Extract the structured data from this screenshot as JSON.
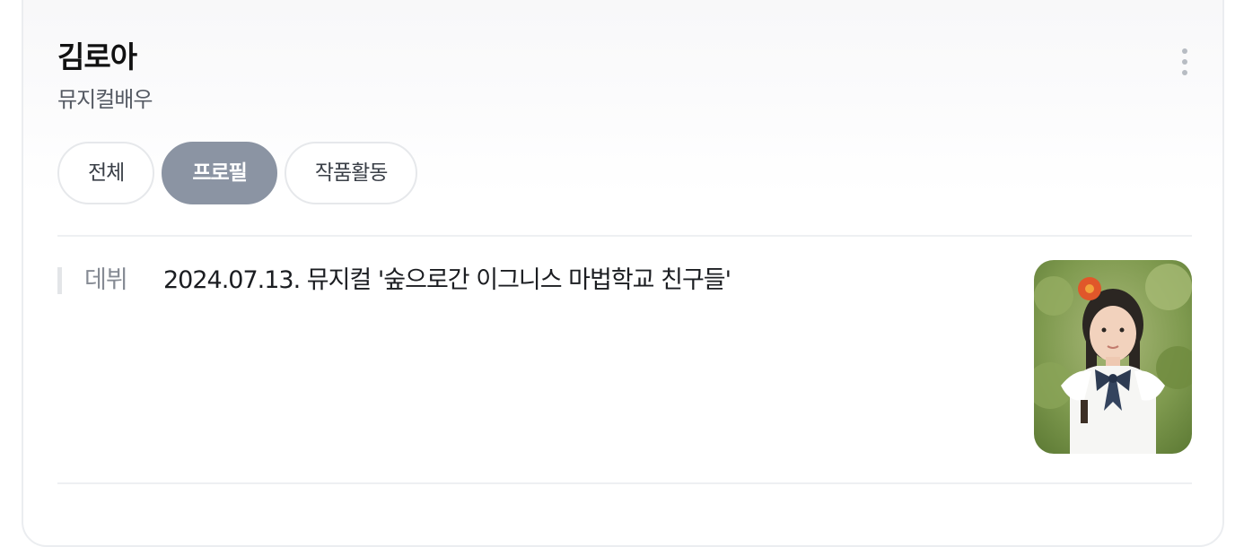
{
  "profile": {
    "name": "김로아",
    "subtitle": "뮤지컬배우"
  },
  "menu": {
    "icon": "more-vertical-icon"
  },
  "tabs": [
    {
      "label": "전체",
      "active": false
    },
    {
      "label": "프로필",
      "active": true
    },
    {
      "label": "작품활동",
      "active": false
    }
  ],
  "info": {
    "label": "데뷔",
    "value": "2024.07.13. 뮤지컬 '숲으로간 이그니스 마법학교 친구들'"
  },
  "photo": {
    "icon": "profile-photo-icon"
  },
  "colors": {
    "active_tab": "#8b94a3",
    "label": "#868b94",
    "text": "#1b1d21"
  }
}
